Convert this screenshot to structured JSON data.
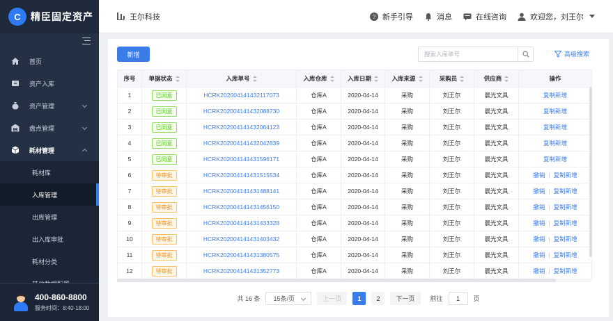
{
  "app": {
    "name": "精臣固定资产",
    "logo_letter": "C"
  },
  "sidebar": {
    "items": [
      {
        "label": "首页",
        "icon": "home-icon"
      },
      {
        "label": "资产入库",
        "icon": "inbox-icon"
      },
      {
        "label": "资产管理",
        "icon": "money-bag-icon",
        "expandable": true
      },
      {
        "label": "盘点管理",
        "icon": "warehouse-icon",
        "expandable": true
      },
      {
        "label": "耗材管理",
        "icon": "cube-icon",
        "expandable": true,
        "open": true
      }
    ],
    "subitems": [
      "耗材库",
      "入库管理",
      "出库管理",
      "出入库审批",
      "耗材分类",
      "其他数据配置"
    ],
    "active_subitem": "入库管理",
    "support": {
      "phone": "400-860-8800",
      "hours": "服务时间：8:40-18:00"
    }
  },
  "header": {
    "company": "王尔科技",
    "guide": "新手引导",
    "messages": "消息",
    "consult": "在线咨询",
    "welcome": "欢迎您，刘王尔"
  },
  "toolbar": {
    "add_label": "新增",
    "search_placeholder": "搜索入库单号",
    "advanced_search": "高级搜索"
  },
  "table": {
    "columns": [
      "序号",
      "单据状态",
      "入库单号",
      "入库仓库",
      "入库日期",
      "入库来源",
      "采购员",
      "供应商",
      "操作"
    ],
    "rows": [
      {
        "no": "1",
        "status": "已同意",
        "status_type": "approved",
        "order": "HCRK202004141432117073",
        "warehouse": "仓库A",
        "date": "2020-04-14",
        "source": "采购",
        "buyer": "刘王尔",
        "supplier": "晨光文具",
        "actions": [
          "复制新增"
        ]
      },
      {
        "no": "2",
        "status": "已同意",
        "status_type": "approved",
        "order": "HCRK202004141432088730",
        "warehouse": "仓库A",
        "date": "2020-04-14",
        "source": "采购",
        "buyer": "刘王尔",
        "supplier": "晨光文具",
        "actions": [
          "复制新增"
        ]
      },
      {
        "no": "3",
        "status": "已同意",
        "status_type": "approved",
        "order": "HCRK202004141432064123",
        "warehouse": "仓库A",
        "date": "2020-04-14",
        "source": "采购",
        "buyer": "刘王尔",
        "supplier": "晨光文具",
        "actions": [
          "复制新增"
        ]
      },
      {
        "no": "4",
        "status": "已同意",
        "status_type": "approved",
        "order": "HCRK202004141432042839",
        "warehouse": "仓库A",
        "date": "2020-04-14",
        "source": "采购",
        "buyer": "刘王尔",
        "supplier": "晨光文具",
        "actions": [
          "复制新增"
        ]
      },
      {
        "no": "5",
        "status": "已同意",
        "status_type": "approved",
        "order": "HCRK202004141431596171",
        "warehouse": "仓库A",
        "date": "2020-04-14",
        "source": "采购",
        "buyer": "刘王尔",
        "supplier": "晨光文具",
        "actions": [
          "复制新增"
        ]
      },
      {
        "no": "6",
        "status": "待审批",
        "status_type": "pending",
        "order": "HCRK202004141431515534",
        "warehouse": "仓库A",
        "date": "2020-04-14",
        "source": "采购",
        "buyer": "刘王尔",
        "supplier": "晨光文具",
        "actions": [
          "撤销",
          "复制新增"
        ]
      },
      {
        "no": "7",
        "status": "待审批",
        "status_type": "pending",
        "order": "HCRK202004141431488141",
        "warehouse": "仓库A",
        "date": "2020-04-14",
        "source": "采购",
        "buyer": "刘王尔",
        "supplier": "晨光文具",
        "actions": [
          "撤销",
          "复制新增"
        ]
      },
      {
        "no": "8",
        "status": "待审批",
        "status_type": "pending",
        "order": "HCRK202004141431456150",
        "warehouse": "仓库A",
        "date": "2020-04-14",
        "source": "采购",
        "buyer": "刘王尔",
        "supplier": "晨光文具",
        "actions": [
          "撤销",
          "复制新增"
        ]
      },
      {
        "no": "9",
        "status": "待审批",
        "status_type": "pending",
        "order": "HCRK202004141431433328",
        "warehouse": "仓库A",
        "date": "2020-04-14",
        "source": "采购",
        "buyer": "刘王尔",
        "supplier": "晨光文具",
        "actions": [
          "撤销",
          "复制新增"
        ]
      },
      {
        "no": "10",
        "status": "待审批",
        "status_type": "pending",
        "order": "HCRK202004141431403432",
        "warehouse": "仓库A",
        "date": "2020-04-14",
        "source": "采购",
        "buyer": "刘王尔",
        "supplier": "晨光文具",
        "actions": [
          "撤销",
          "复制新增"
        ]
      },
      {
        "no": "11",
        "status": "待审批",
        "status_type": "pending",
        "order": "HCRK202004141431380575",
        "warehouse": "仓库A",
        "date": "2020-04-14",
        "source": "采购",
        "buyer": "刘王尔",
        "supplier": "晨光文具",
        "actions": [
          "撤销",
          "复制新增"
        ]
      },
      {
        "no": "12",
        "status": "待审批",
        "status_type": "pending",
        "order": "HCRK202004141431352773",
        "warehouse": "仓库A",
        "date": "2020-04-14",
        "source": "采购",
        "buyer": "刘王尔",
        "supplier": "晨光文具",
        "actions": [
          "撤销",
          "复制新增"
        ]
      }
    ]
  },
  "pagination": {
    "total": "共 16 条",
    "page_size": "15条/页",
    "prev": "上一页",
    "pages": [
      "1",
      "2"
    ],
    "current": "1",
    "next": "下一页",
    "goto_label": "前往",
    "goto_value": "1",
    "goto_suffix": "页"
  },
  "colors": {
    "accent": "#3a7de8",
    "sidebar": "#243145",
    "approved": "#52c41a",
    "pending": "#fa8c16"
  }
}
